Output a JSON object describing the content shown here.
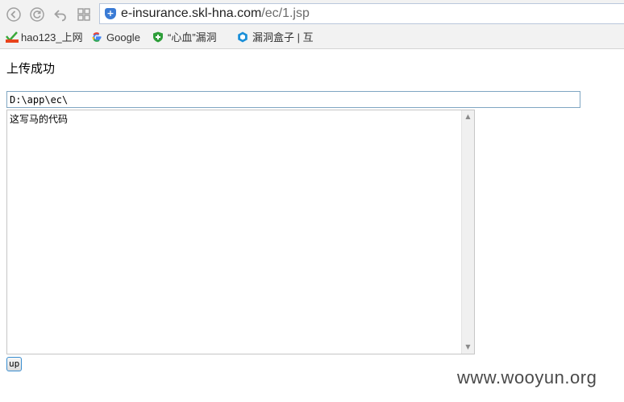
{
  "browser": {
    "url_host": "e-insurance.skl-hna.com",
    "url_path": "/ec/1.jsp",
    "bookmarks": [
      {
        "label": "hao123_上网",
        "icon": "hao123-icon"
      },
      {
        "label": "Google",
        "icon": "google-icon"
      },
      {
        "label": "“心血”漏洞",
        "icon": "shield-green-icon"
      },
      {
        "label": "漏洞盒子 | 互",
        "icon": "hexagon-blue-icon"
      }
    ]
  },
  "page": {
    "title": "上传成功",
    "path_value": "D:\\app\\ec\\",
    "code_value": "这写马的代码",
    "submit_label": "up"
  },
  "watermark": "www.wooyun.org"
}
